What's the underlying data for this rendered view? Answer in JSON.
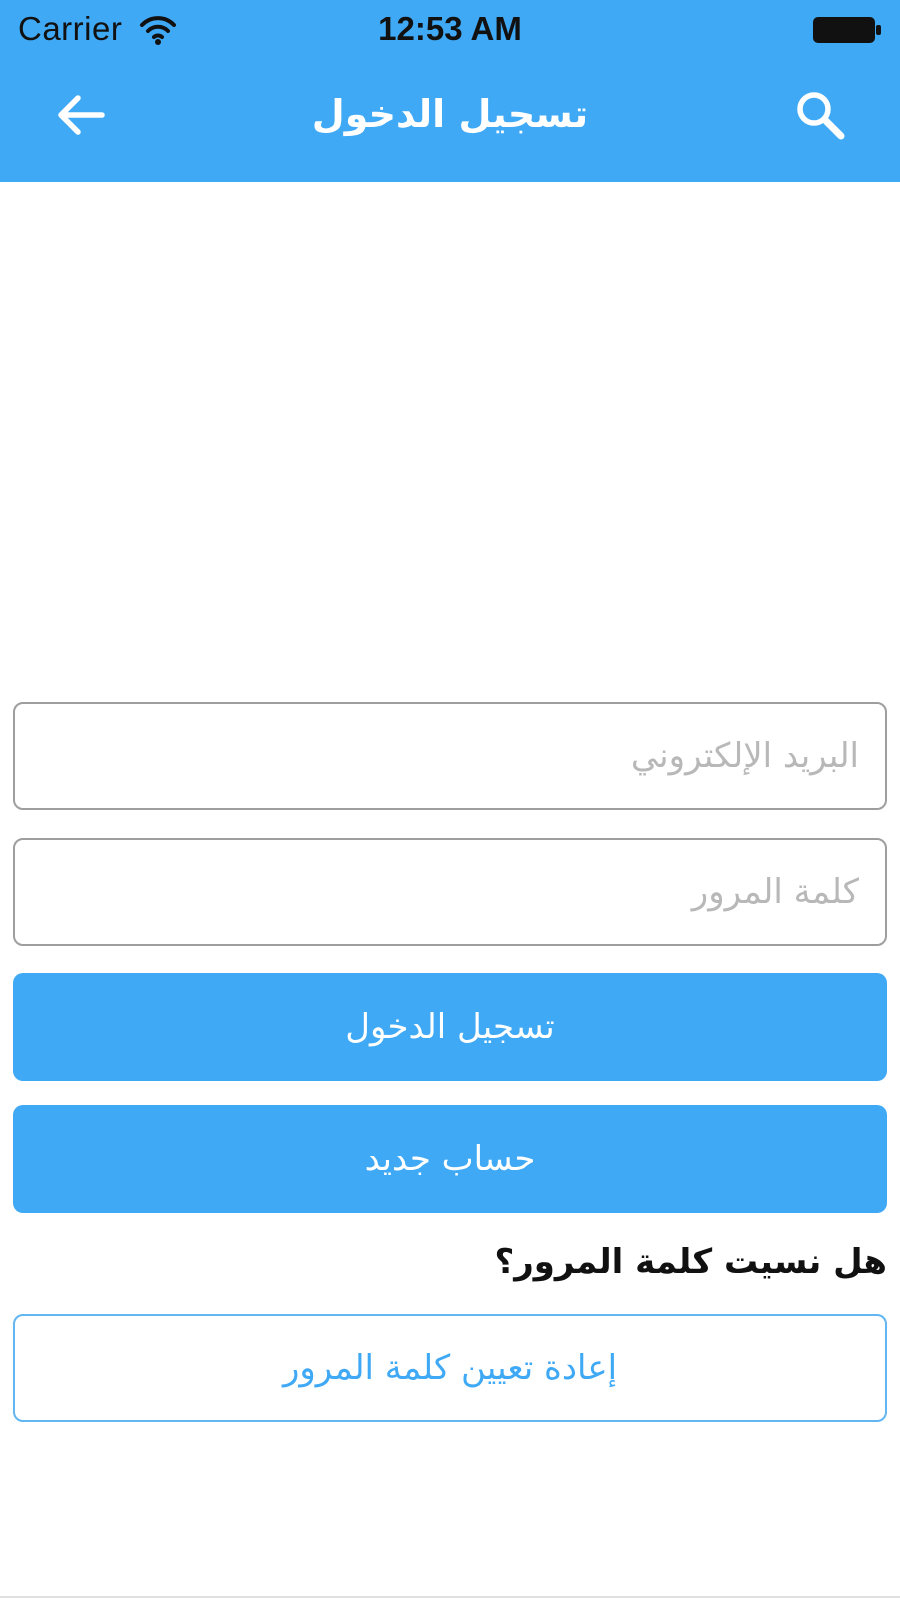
{
  "status_bar": {
    "carrier": "Carrier",
    "time": "12:53 AM"
  },
  "nav_bar": {
    "title": "تسجيل الدخول",
    "back_icon": "arrow-left-icon",
    "search_icon": "search-icon"
  },
  "form": {
    "email_placeholder": "البريد الإلكتروني",
    "email_value": "",
    "password_placeholder": "كلمة المرور",
    "password_value": "",
    "login_label": "تسجيل الدخول",
    "register_label": "حساب جديد",
    "forgot_label": "هل نسيت كلمة المرور؟",
    "reset_label": "إعادة تعيين كلمة المرور"
  },
  "colors": {
    "primary": "#3fa9f5",
    "background": "#ffffff",
    "field_border": "#9e9e9e",
    "placeholder": "#b8b8b8"
  }
}
